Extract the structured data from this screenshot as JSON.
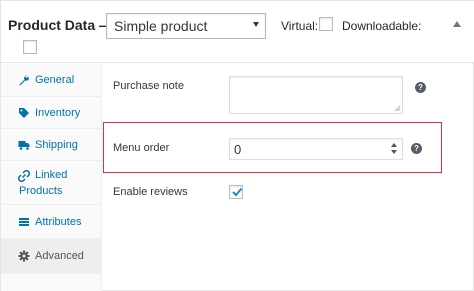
{
  "header": {
    "title": "Product Data —",
    "product_type": {
      "selected": "Simple product"
    },
    "virtual_label": "Virtual:",
    "virtual_checked": false,
    "downloadable_label": "Downloadable:",
    "downloadable_checked": false
  },
  "tabs": [
    {
      "label": "General",
      "icon": "wrench-icon",
      "active": false
    },
    {
      "label": "Inventory",
      "icon": "tag-icon",
      "active": false
    },
    {
      "label": "Shipping",
      "icon": "truck-icon",
      "active": false
    },
    {
      "label_line1": "Linked",
      "label_line2": "Products",
      "icon": "link-icon",
      "active": false
    },
    {
      "label": "Attributes",
      "icon": "list-icon",
      "active": false
    },
    {
      "label": "Advanced",
      "icon": "gear-icon",
      "active": true
    }
  ],
  "advanced": {
    "purchase_note_label": "Purchase note",
    "purchase_note_value": "",
    "menu_order_label": "Menu order",
    "menu_order_value": "0",
    "enable_reviews_label": "Enable reviews",
    "enable_reviews_checked": true,
    "help_glyph": "?"
  },
  "colors": {
    "link": "#0073aa",
    "highlight_border": "#d9323b",
    "active_tab_bg": "#eeeeee",
    "help_bg": "#555d66"
  }
}
